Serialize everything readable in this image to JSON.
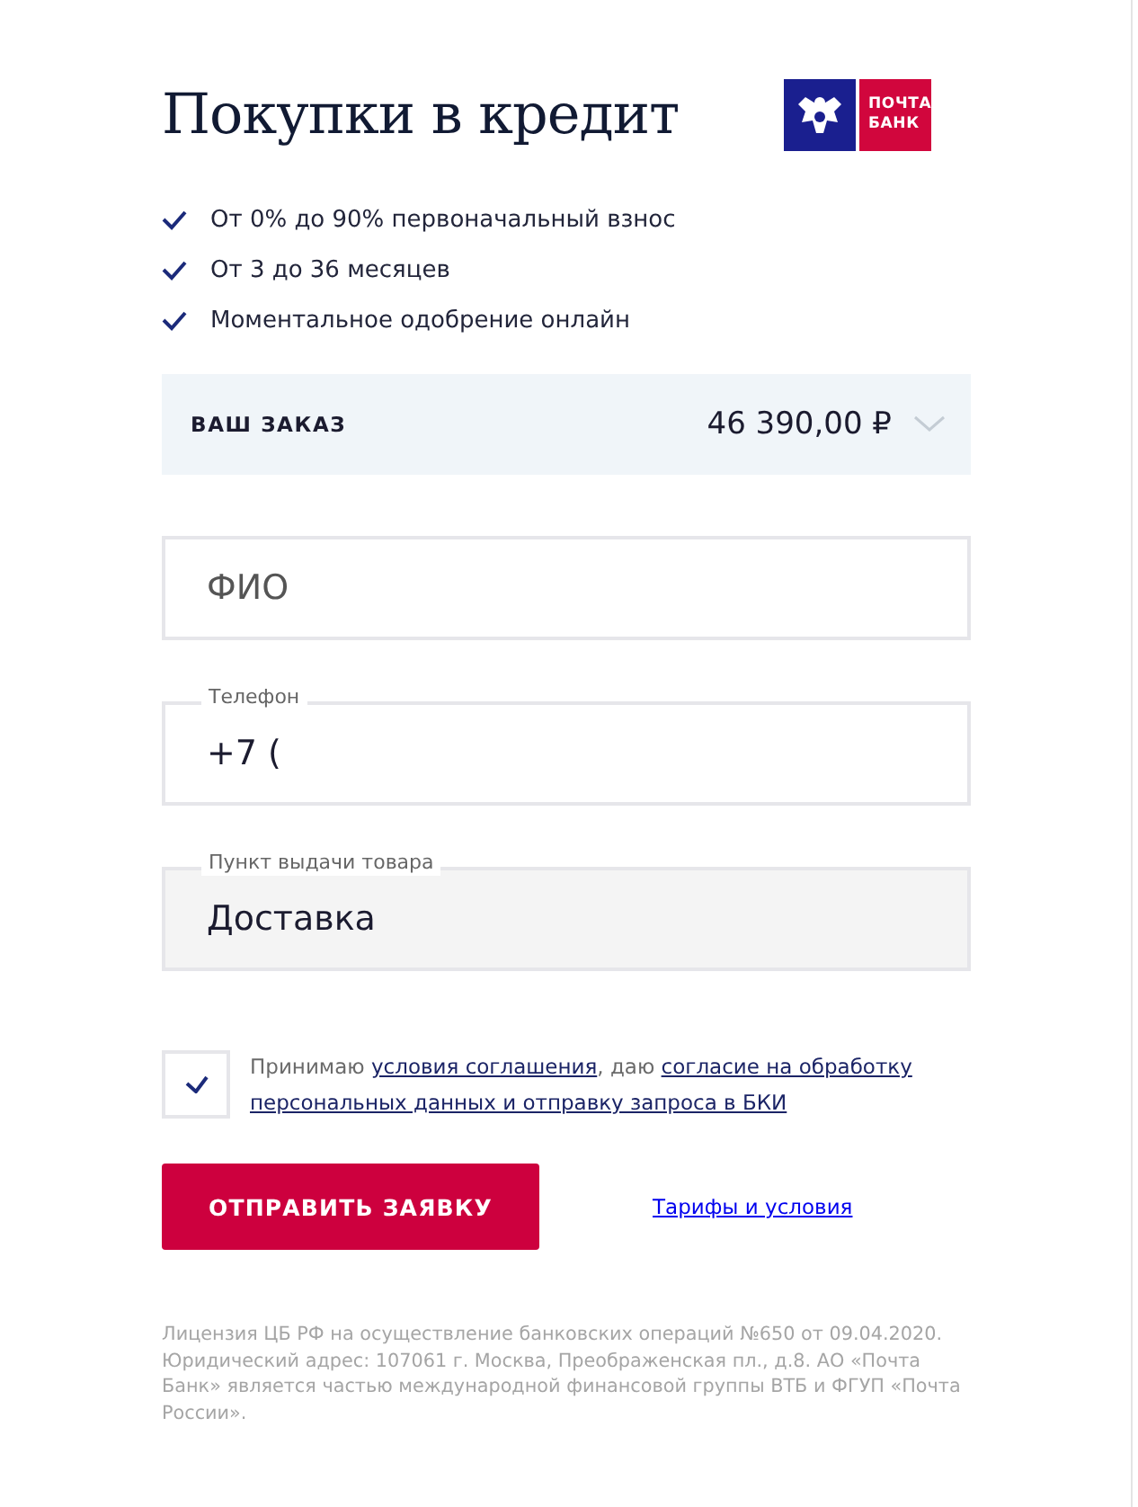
{
  "title": "Покупки в кредит",
  "logo": {
    "text_lines": [
      "ПОЧТА",
      "БАНК"
    ]
  },
  "benefits": [
    {
      "text": "От 0% до 90% первоначальный взнос"
    },
    {
      "text": "От 3 до 36 месяцев"
    },
    {
      "text": "Моментальное одобрение онлайн"
    }
  ],
  "order": {
    "label": "ВАШ ЗАКАЗ",
    "amount": "46 390,00 ₽",
    "expanded": false
  },
  "fields": [
    {
      "kind": "text",
      "placeholder": "ФИО"
    },
    {
      "kind": "text",
      "label": "Телефон",
      "value": "+7 ("
    },
    {
      "kind": "select",
      "label": "Пункт выдачи товара",
      "value": "Доставка"
    }
  ],
  "consent": {
    "checked": true,
    "parts": [
      {
        "kind": "text",
        "text": "Принимаю "
      },
      {
        "kind": "link",
        "text": "условия соглашения"
      },
      {
        "kind": "text",
        "text": ", даю "
      },
      {
        "kind": "link",
        "text": "согласие на обработку"
      },
      {
        "kind": "link",
        "text": "персональных данных и отправку запроса в БКИ"
      }
    ]
  },
  "submit": {
    "label": "ОТПРАВИТЬ ЗАЯВКУ"
  },
  "tariffs_link": {
    "text": "Тарифы и условия"
  },
  "legal": "Лицензия ЦБ РФ на осуществление банковских операций №650 от 09.04.2020. Юридический адрес: 107061 г. Москва, Преображенская пл., д.8. АО «Почта Банк» является частью международной финансовой группы ВТБ и ФГУП «Почта России»."
}
